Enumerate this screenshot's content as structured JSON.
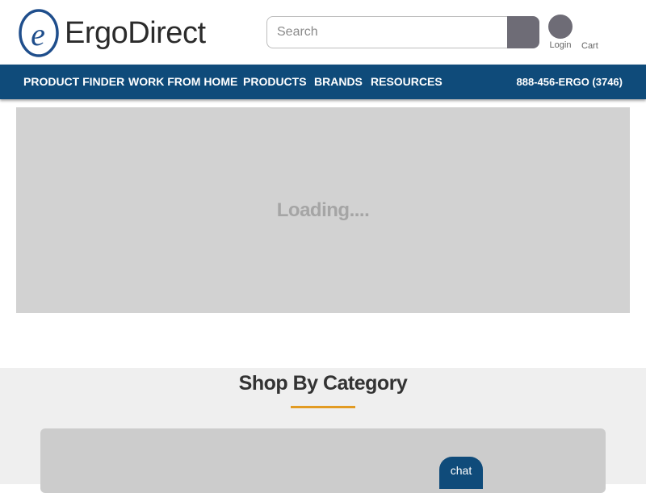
{
  "brand": {
    "name": "ErgoDirect",
    "logo_letter": "e",
    "color": "#1f4e8c"
  },
  "search": {
    "placeholder": "Search"
  },
  "account": {
    "login_label": "Login",
    "cart_label": "Cart"
  },
  "nav": {
    "items": [
      {
        "label": "PRODUCT FINDER"
      },
      {
        "label": "WORK FROM HOME"
      },
      {
        "label": "PRODUCTS"
      },
      {
        "label": "BRANDS"
      },
      {
        "label": "RESOURCES"
      }
    ],
    "phone": "888-456-ERGO (3746)",
    "background": "#0f4b7a"
  },
  "hero": {
    "loading_text": "Loading...."
  },
  "shop": {
    "title": "Shop By Category",
    "accent": "#e29b23"
  },
  "chat": {
    "label": "chat"
  }
}
